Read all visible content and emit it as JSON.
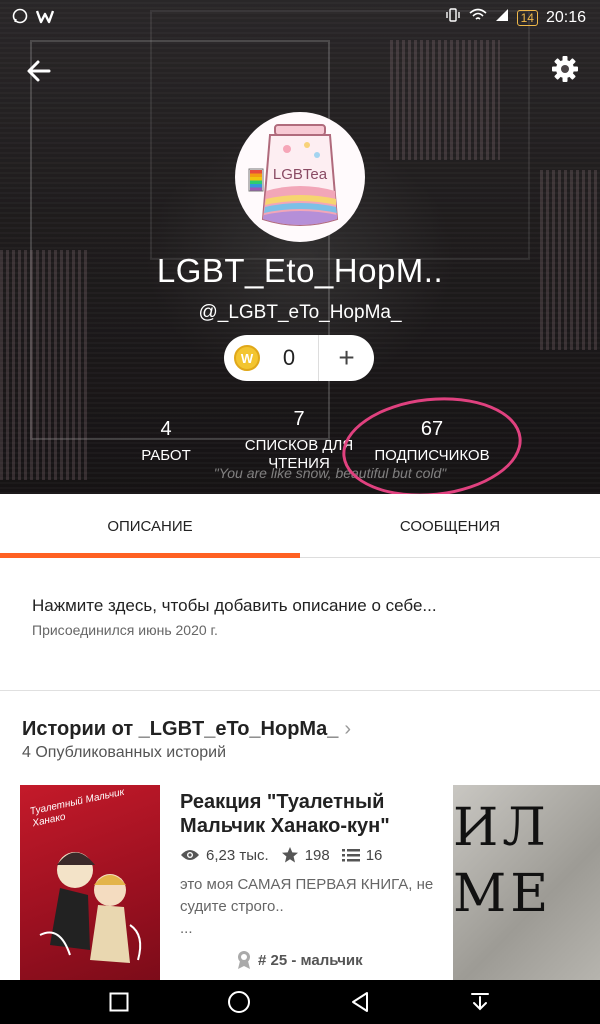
{
  "status_bar": {
    "time": "20:16",
    "battery": "14"
  },
  "profile": {
    "display_name": "LGBT_Eto_HopM..",
    "handle": "@_LGBT_eTo_HopMa_",
    "avatar_text": "LGBTea",
    "coins": "0",
    "add_label": "+",
    "quote": "\"You are like snow, beautiful but cold\"",
    "stats": [
      {
        "value": "4",
        "label": "РАБОТ"
      },
      {
        "value": "7",
        "label": "СПИСКОВ ДЛЯ ЧТЕНИЯ"
      },
      {
        "value": "67",
        "label": "ПОДПИСЧИКОВ"
      }
    ]
  },
  "tabs": [
    {
      "label": "ОПИСАНИЕ",
      "active": true
    },
    {
      "label": "СООБЩЕНИЯ",
      "active": false
    }
  ],
  "about": {
    "prompt": "Нажмите здесь, чтобы добавить описание о себе...",
    "joined": "Присоединился июнь 2020 г."
  },
  "stories": {
    "title": "Истории от _LGBT_eTo_HopMa_",
    "subtitle": "4 Опубликованных историй",
    "items": [
      {
        "title": "Реакция \"Туалетный Мальчик Ханако-кун\"",
        "cover_text": "Туалетный Мальчик Ханако",
        "views": "6,23 тыс.",
        "votes": "198",
        "parts": "16",
        "description": "это моя САМАЯ ПЕРВАЯ КНИГА, не судите строго..",
        "ellipsis": "...",
        "rank": "# 25 - мальчик"
      }
    ],
    "second_cover_text": "ИЛ МЕ"
  },
  "colors": {
    "accent": "#ff6122",
    "circle": "#e0417f"
  }
}
